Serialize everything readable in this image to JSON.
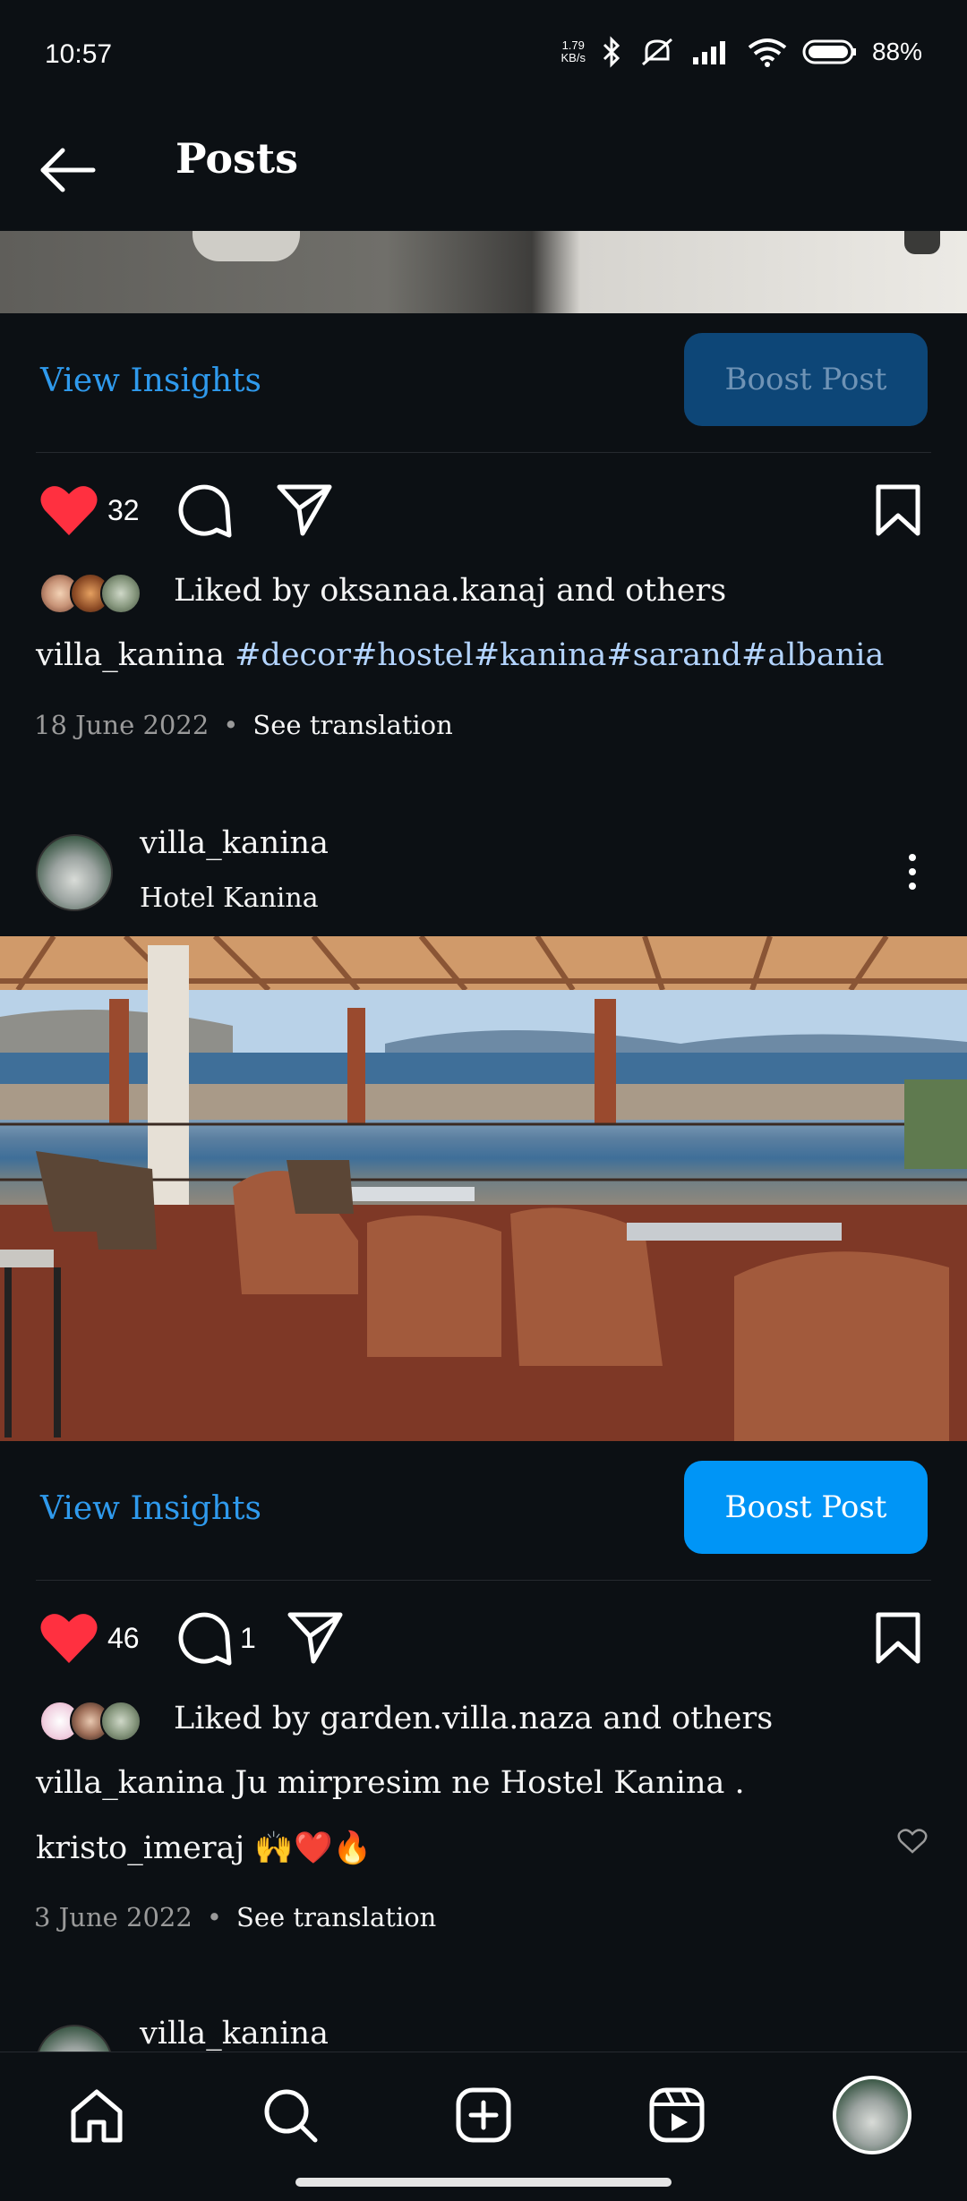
{
  "status_bar": {
    "time": "10:57",
    "net_speed_value": "1.79",
    "net_speed_unit": "KB/s",
    "battery": "88%"
  },
  "header": {
    "title": "Posts"
  },
  "post1": {
    "view_insights": "View Insights",
    "boost_label": "Boost Post",
    "likes": "32",
    "liked_by_text": "Liked by oksanaa.kanaj and others",
    "caption_user": "villa_kanina",
    "caption_tags": "#decor#hostel#kanina#sarand#albania",
    "date": "18 June 2022",
    "see_translation": "See translation"
  },
  "post2": {
    "username": "villa_kanina",
    "location": "Hotel Kanina",
    "view_insights": "View Insights",
    "boost_label": "Boost Post",
    "likes": "46",
    "comments": "1",
    "liked_by_text": "Liked by garden.villa.naza and others",
    "caption_user": "villa_kanina",
    "caption_text": "Ju mirpresim ne Hostel Kanina .",
    "comment_user": "kristo_imeraj",
    "comment_text": "🙌❤️🔥",
    "date": "3 June 2022",
    "see_translation": "See translation"
  },
  "post3": {
    "username": "villa_kanina"
  },
  "colors": {
    "background": "#0c1014",
    "accent_blue": "#0095f6",
    "insights_blue": "#2f9aed",
    "like_red": "#ff3040",
    "hashtag": "#b3d4ff"
  },
  "icons": [
    "back-arrow-icon",
    "heart-icon",
    "comment-icon",
    "share-icon",
    "bookmark-icon",
    "more-icon",
    "home-icon",
    "search-icon",
    "create-icon",
    "reels-icon",
    "profile-icon"
  ]
}
